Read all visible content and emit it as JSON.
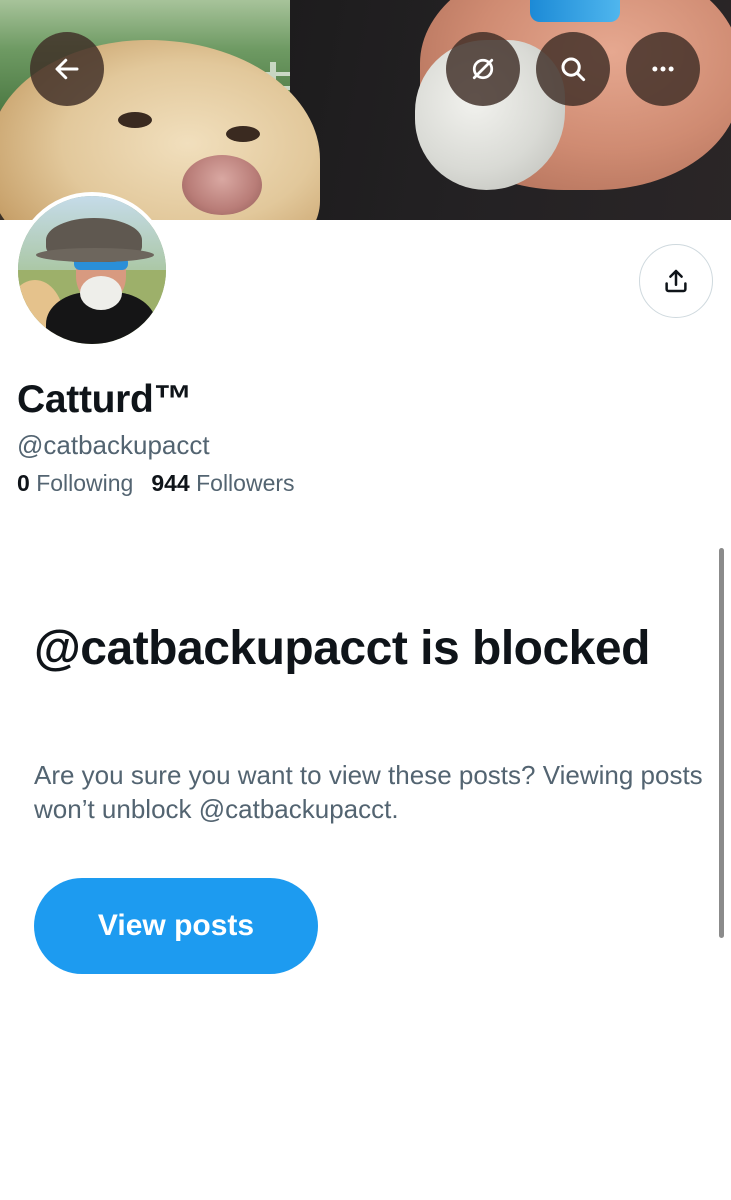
{
  "header": {
    "back_icon": "arrow-left-icon",
    "grok_icon": "grok-icon",
    "search_icon": "search-icon",
    "more_icon": "more-horizontal-icon"
  },
  "profile": {
    "display_name": "Catturd™",
    "handle": "@catbackupacct",
    "following_count": "0",
    "following_label": "Following",
    "followers_count": "944",
    "followers_label": "Followers",
    "share_icon": "share-icon"
  },
  "blocked_notice": {
    "title": "@catbackupacct is blocked",
    "message": "Are you sure you want to view these posts? Viewing posts won’t unblock @catbackupacct.",
    "button_label": "View posts"
  },
  "colors": {
    "accent": "#1d9bf0",
    "text_primary": "#0f1419",
    "text_secondary": "#536471"
  }
}
